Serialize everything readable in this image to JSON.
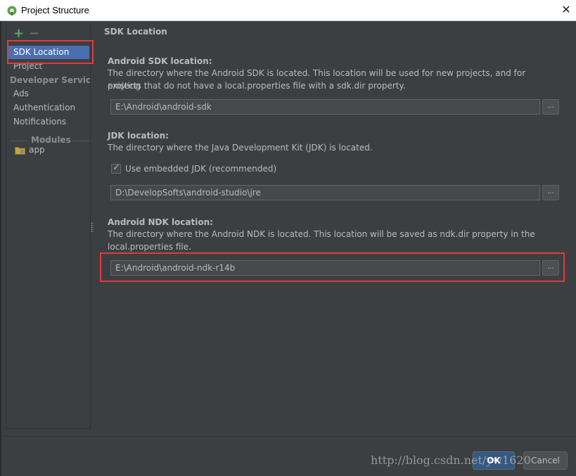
{
  "window": {
    "title": "Project Structure",
    "close_glyph": "✕"
  },
  "sidebar": {
    "add_glyph": "+",
    "remove_glyph": "−",
    "items": [
      {
        "label": "SDK Location"
      },
      {
        "label": "Project"
      },
      {
        "label": "Developer Servic..."
      },
      {
        "label": "Ads"
      },
      {
        "label": "Authentication"
      },
      {
        "label": "Notifications"
      },
      {
        "label": "Modules"
      },
      {
        "label": "app"
      }
    ]
  },
  "main": {
    "section_title": "SDK Location",
    "android_sdk": {
      "label": "Android SDK location:",
      "desc_line1": "The directory where the Android SDK is located. This location will be used for new projects, and for existing",
      "desc_line2": "projects that do not have a local.properties file with a sdk.dir property.",
      "value": "E:\\Android\\android-sdk",
      "browse": "..."
    },
    "jdk": {
      "label": "JDK location:",
      "desc": "The directory where the Java Development Kit (JDK) is located.",
      "checkbox_label": "Use embedded JDK (recommended)",
      "checkbox_checked": true,
      "value": "D:\\DevelopSofts\\android-studio\\jre",
      "browse": "..."
    },
    "android_ndk": {
      "label": "Android NDK location:",
      "desc_line1": "The directory where the Android NDK is located. This location will be saved as ndk.dir property in the",
      "desc_line2": "local.properties file.",
      "value": "E:\\Android\\android-ndk-r14b",
      "browse": "..."
    }
  },
  "footer": {
    "ok_label": "OK",
    "cancel_label": "Cancel"
  },
  "watermark": "http://blog.csdn.net/yw1620",
  "colors": {
    "background": "#3c3f41",
    "selection": "#4b6eaf",
    "highlight_box": "#e33b3b",
    "ok_button": "#365880"
  }
}
